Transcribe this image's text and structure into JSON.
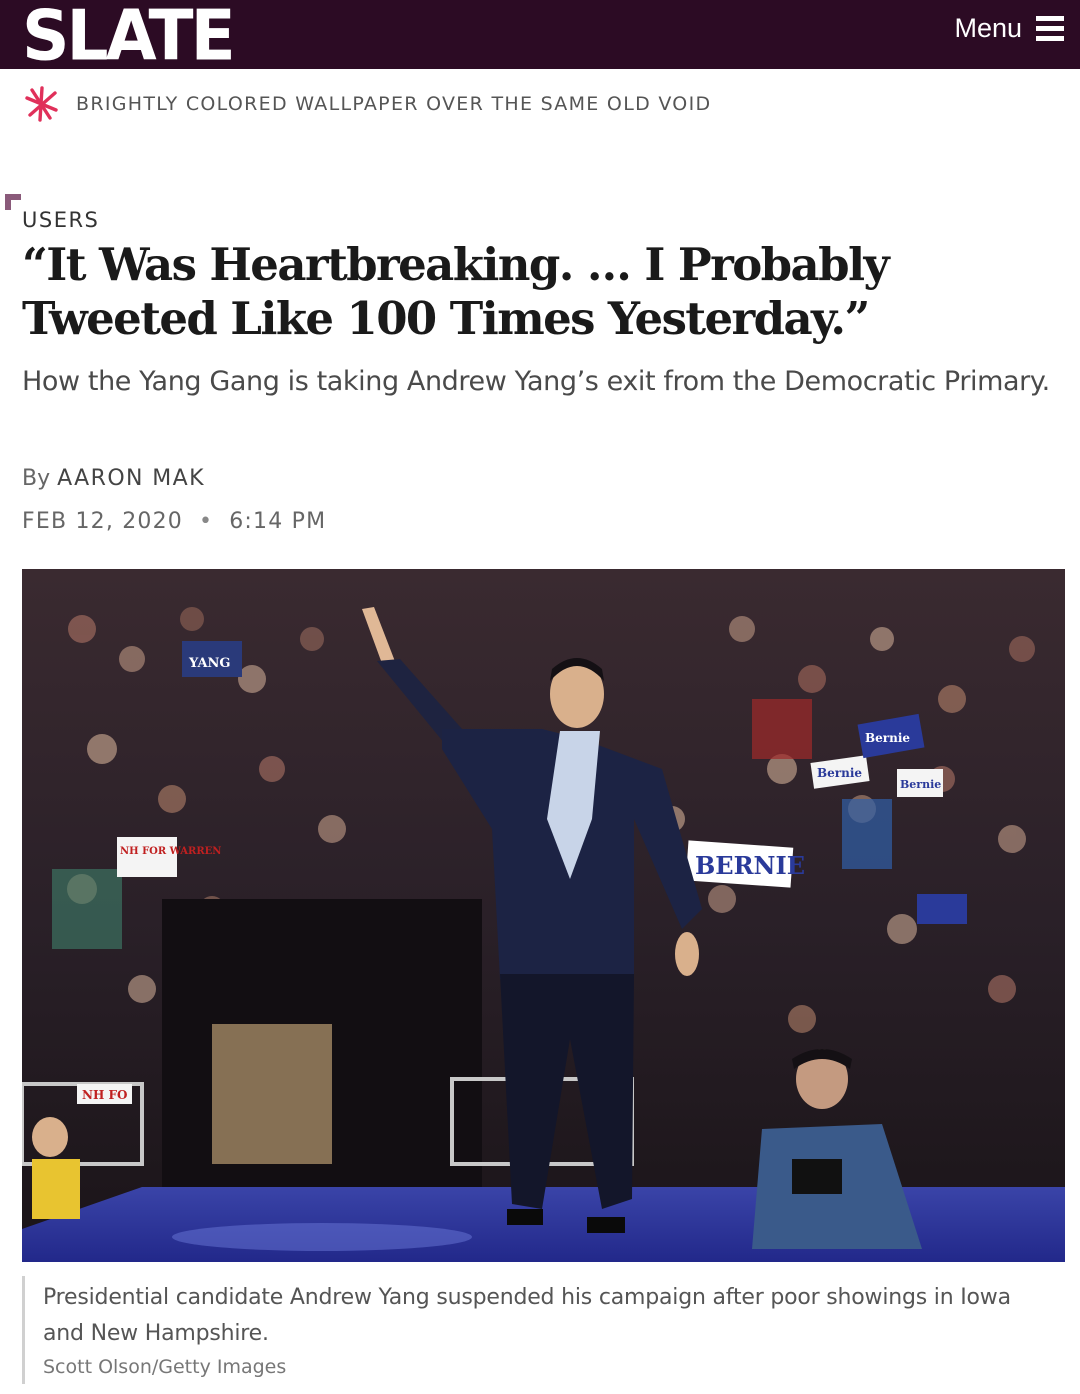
{
  "header": {
    "logo_text": "SLATE",
    "menu_label": "Menu",
    "background_color": "#2c0b24"
  },
  "tagline": {
    "icon": "slate-asterisk-icon",
    "text": "BRIGHTLY COLORED WALLPAPER OVER THE SAME OLD VOID",
    "accent_color": "#e0305a"
  },
  "article": {
    "section": "USERS",
    "headline": "“It Was Heartbreaking. … I Probably Tweeted Like 100 Times Yesterday.”",
    "dek": "How the Yang Gang is taking Andrew Yang’s exit from the Democratic Primary.",
    "byline_prefix": "By",
    "author": "AARON MAK",
    "date": "FEB 12, 2020",
    "separator": "•",
    "time": "6:14 PM"
  },
  "image": {
    "caption": "Presidential candidate Andrew Yang suspended his campaign after poor showings in Iowa and New Hampshire.",
    "credit": "Scott Olson/Getty Images",
    "signs": [
      "YANG",
      "Bernie",
      "Bernie",
      "Bernie",
      "BERNIE",
      "NH FOR WARREN",
      "NH FO"
    ]
  }
}
